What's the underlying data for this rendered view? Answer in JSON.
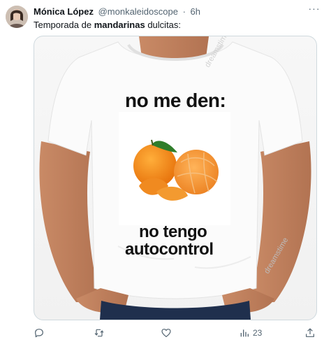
{
  "tweet": {
    "author_name": "Mónica López",
    "author_handle": "@monkaleidoscope",
    "separator": "·",
    "time": "6h",
    "text_before": "Temporada de ",
    "text_bold": "mandarinas",
    "text_after": " dulcitas:",
    "more_label": "···"
  },
  "image": {
    "caption_top": "no me den:",
    "caption_bottom_line1": "no tengo",
    "caption_bottom_line2": "autocontrol",
    "watermark": "dreamstime"
  },
  "actions": {
    "reply_icon": "reply-icon",
    "retweet_icon": "retweet-icon",
    "like_icon": "heart-icon",
    "views_icon": "analytics-icon",
    "views_count": "23",
    "share_icon": "share-icon"
  },
  "colors": {
    "text_primary": "#0f1419",
    "text_secondary": "#536471",
    "border": "#cfd9de"
  }
}
